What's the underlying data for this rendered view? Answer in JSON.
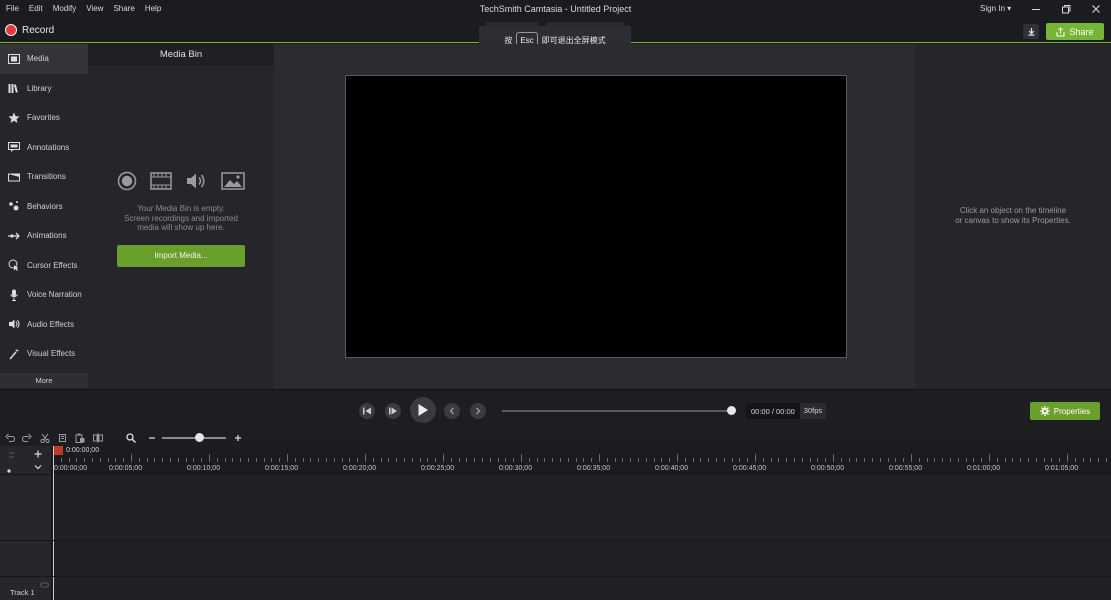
{
  "menu": [
    "File",
    "Edit",
    "Modify",
    "View",
    "Share",
    "Help"
  ],
  "window": {
    "title": "TechSmith Camtasia - Untitled Project",
    "signin": "Sign In ▾"
  },
  "record": {
    "label": "Record"
  },
  "fullscreen_toast": {
    "prefix": "按",
    "key": "Esc",
    "suffix": "即可退出全屏模式"
  },
  "share": {
    "label": "Share"
  },
  "sidebar": {
    "items": [
      {
        "label": "Media",
        "icon": "film-strip-icon"
      },
      {
        "label": "Library",
        "icon": "library-books-icon"
      },
      {
        "label": "Favorites",
        "icon": "star-icon"
      },
      {
        "label": "Annotations",
        "icon": "annotation-icon"
      },
      {
        "label": "Transitions",
        "icon": "transition-icon"
      },
      {
        "label": "Behaviors",
        "icon": "behaviors-icon"
      },
      {
        "label": "Animations",
        "icon": "animation-arrow-icon"
      },
      {
        "label": "Cursor Effects",
        "icon": "cursor-effects-icon"
      },
      {
        "label": "Voice Narration",
        "icon": "microphone-icon"
      },
      {
        "label": "Audio Effects",
        "icon": "speaker-icon"
      },
      {
        "label": "Visual Effects",
        "icon": "magic-wand-icon"
      }
    ],
    "more": "More"
  },
  "media_bin": {
    "title": "Media Bin",
    "empty_line1": "Your Media Bin is empty.",
    "empty_line2": "Screen recordings and imported",
    "empty_line3": "media will show up here.",
    "import_label": "Import Media..."
  },
  "properties_panel": {
    "hint_line1": "Click an object on the timeline",
    "hint_line2": "or canvas to show its Properties."
  },
  "playback": {
    "timecode": "00:00 / 00:00",
    "fps": "30fps",
    "properties_label": "Properties"
  },
  "timeline": {
    "playhead": "0:00:00;00",
    "ruler": [
      "0:00:00;00",
      "0:00:05;00",
      "0:00:10;00",
      "0:00:15;00",
      "0:00:20;00",
      "0:00:25;00",
      "0:00:30;00",
      "0:00:35;00",
      "0:00:40;00",
      "0:00:45;00",
      "0:00:50;00",
      "0:00:55;00",
      "0:01:00;00",
      "0:01:05;00"
    ],
    "track_label": "Track 1"
  },
  "colors": {
    "accent": "#76b536",
    "record": "#e6373c",
    "panel": "#25262b",
    "canvas": "#000000"
  }
}
